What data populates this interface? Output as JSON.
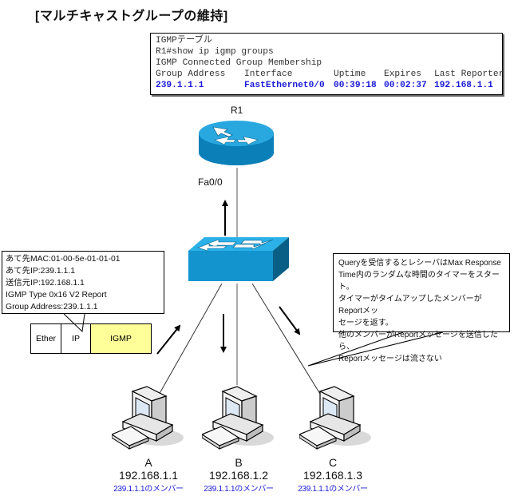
{
  "title": "[マルチキャストグループの維持]",
  "igmp_table": {
    "heading": "IGMPテーブル",
    "command": "R1#show ip igmp groups",
    "subtitle": "IGMP Connected Group Membership",
    "columns": [
      "Group Address",
      "Interface",
      "Uptime",
      "Expires",
      "Last Reporter"
    ],
    "rows": [
      [
        "239.1.1.1",
        "FastEthernet0/0",
        "00:39:18",
        "00:02:37",
        "192.168.1.1"
      ]
    ]
  },
  "router": {
    "name": "R1",
    "interface": "Fa0/0"
  },
  "packet_callout": {
    "lines": [
      "あて先MAC:01-00-5e-01-01-01",
      "あて先IP:239.1.1.1",
      "送信元IP:192.168.1.1",
      "IGMP Type 0x16 V2 Report",
      "Group Address:239.1.1.1"
    ]
  },
  "frame": {
    "fields": [
      "Ether",
      "IP",
      "IGMP"
    ],
    "highlight_color": "#ffff99"
  },
  "note_callout": {
    "lines": [
      "Queryを受信するとレシーバはMax Response",
      "Time内のランダムな時間のタイマーをスタート。",
      "タイマーがタイムアップしたメンバーがReportメッ",
      "セージを返す。",
      "他のメンバーがReportメッセージを送信したら、",
      "Reportメッセージは流さない"
    ]
  },
  "hosts": [
    {
      "name": "A",
      "ip": "192.168.1.1",
      "membership": "239.1.1.1のメンバー"
    },
    {
      "name": "B",
      "ip": "192.168.1.2",
      "membership": "239.1.1.1のメンバー"
    },
    {
      "name": "C",
      "ip": "192.168.1.3",
      "membership": "239.1.1.1のメンバー"
    }
  ],
  "colors": {
    "device_blue": "#1e9bd7",
    "device_dark": "#0a5f86",
    "member_text": "#1a1ad6"
  }
}
